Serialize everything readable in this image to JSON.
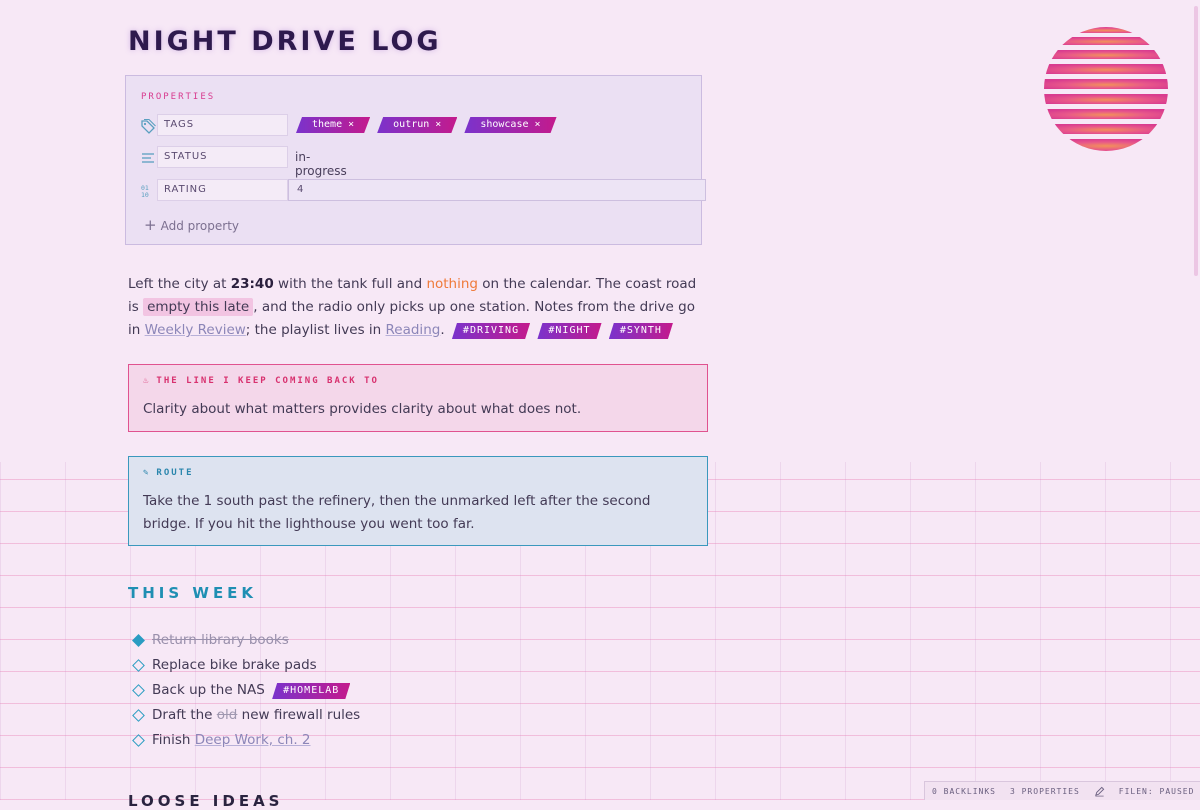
{
  "note": {
    "title": "NIGHT DRIVE LOG"
  },
  "properties": {
    "heading": "PROPERTIES",
    "tags": {
      "key": "TAGS",
      "values": [
        "theme ×",
        "outrun ×",
        "showcase ×"
      ]
    },
    "status": {
      "key": "STATUS",
      "value": "in-progress"
    },
    "rating": {
      "key": "RATING",
      "value": "4"
    },
    "add_label": "Add property",
    "add_symbol": "+"
  },
  "paragraph": {
    "p1": "Left the city at ",
    "time": "23:40",
    "p2": " with the tank full and ",
    "orange": "nothing",
    "p3": " on the calendar. The coast road is ",
    "highlight": "empty this late",
    "p4": ", and the radio only picks up one station. Notes from the drive go in ",
    "link1": "Weekly Review",
    "p5": "; the playlist lives in ",
    "link2": "Reading",
    "p6": ".",
    "tags": [
      "#DRIVING",
      "#NIGHT",
      "#SYNTH"
    ]
  },
  "quote_callout": {
    "icon": "♨",
    "title": "THE LINE I KEEP COMING BACK TO",
    "body": "Clarity about what matters provides clarity about what does not."
  },
  "route_callout": {
    "icon": "✎",
    "title": "ROUTE",
    "body": "Take the 1 south past the refinery, then the unmarked left after the second bridge. If you hit the lighthouse you went too far."
  },
  "this_week": {
    "title": "THIS WEEK",
    "tasks": [
      {
        "text": "Return library books",
        "done": true
      },
      {
        "text": "Replace bike brake pads",
        "done": false
      },
      {
        "text": "Back up the NAS ",
        "tag": "#HOMELAB",
        "done": false
      },
      {
        "pre": "Draft the ",
        "strike": "old",
        "post": " new firewall rules",
        "done": false
      },
      {
        "pre": "Finish ",
        "link": "Deep Work, ch. 2",
        "done": false
      }
    ]
  },
  "next_section": {
    "title": "LOOSE IDEAS"
  },
  "status_bar": {
    "backlinks": "0 BACKLINKS",
    "properties": "3 PROPERTIES",
    "sync": "FILEN: PAUSED"
  },
  "colors": {
    "accent_pink": "#d83b8f",
    "accent_cyan": "#2a9cc2",
    "tag_gradient_start": "#7a33cc",
    "tag_gradient_end": "#c41a8c",
    "background": "#f7e8f6"
  }
}
